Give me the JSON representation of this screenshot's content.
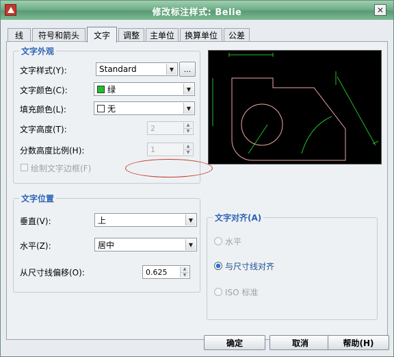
{
  "window": {
    "title": "修改标注样式: Belie"
  },
  "tabs": [
    {
      "label": "线"
    },
    {
      "label": "符号和箭头"
    },
    {
      "label": "文字",
      "active": true
    },
    {
      "label": "调整"
    },
    {
      "label": "主单位"
    },
    {
      "label": "换算单位"
    },
    {
      "label": "公差"
    }
  ],
  "text_appearance": {
    "title": "文字外观",
    "style_label": "文字样式(Y):",
    "style_value": "Standard",
    "style_button": "...",
    "color_label": "文字颜色(C):",
    "color_value": "绿",
    "color_swatch": "#22c02a",
    "fill_label": "填充颜色(L):",
    "fill_value": "无",
    "height_label": "文字高度(T):",
    "height_value": "2",
    "scale_label": "分数高度比例(H):",
    "scale_value": "1",
    "frame_label": "绘制文字边框(F)"
  },
  "text_placement": {
    "title": "文字位置",
    "vertical_label": "垂直(V):",
    "vertical_value": "上",
    "horizontal_label": "水平(Z):",
    "horizontal_value": "居中",
    "offset_label": "从尺寸线偏移(O):",
    "offset_value": "0.625"
  },
  "text_alignment": {
    "title": "文字对齐(A)",
    "options": [
      {
        "label": "水平",
        "checked": false
      },
      {
        "label": "与尺寸线对齐",
        "checked": true
      },
      {
        "label": "ISO 标准",
        "checked": false
      }
    ]
  },
  "buttons": {
    "ok": "确定",
    "cancel": "取消",
    "help": "帮助(H)"
  },
  "colors": {
    "accent": "#2d62b5",
    "preview_bg": "#000000",
    "preview_line": "#22c02a",
    "preview_shape": "#f0a8a8"
  }
}
